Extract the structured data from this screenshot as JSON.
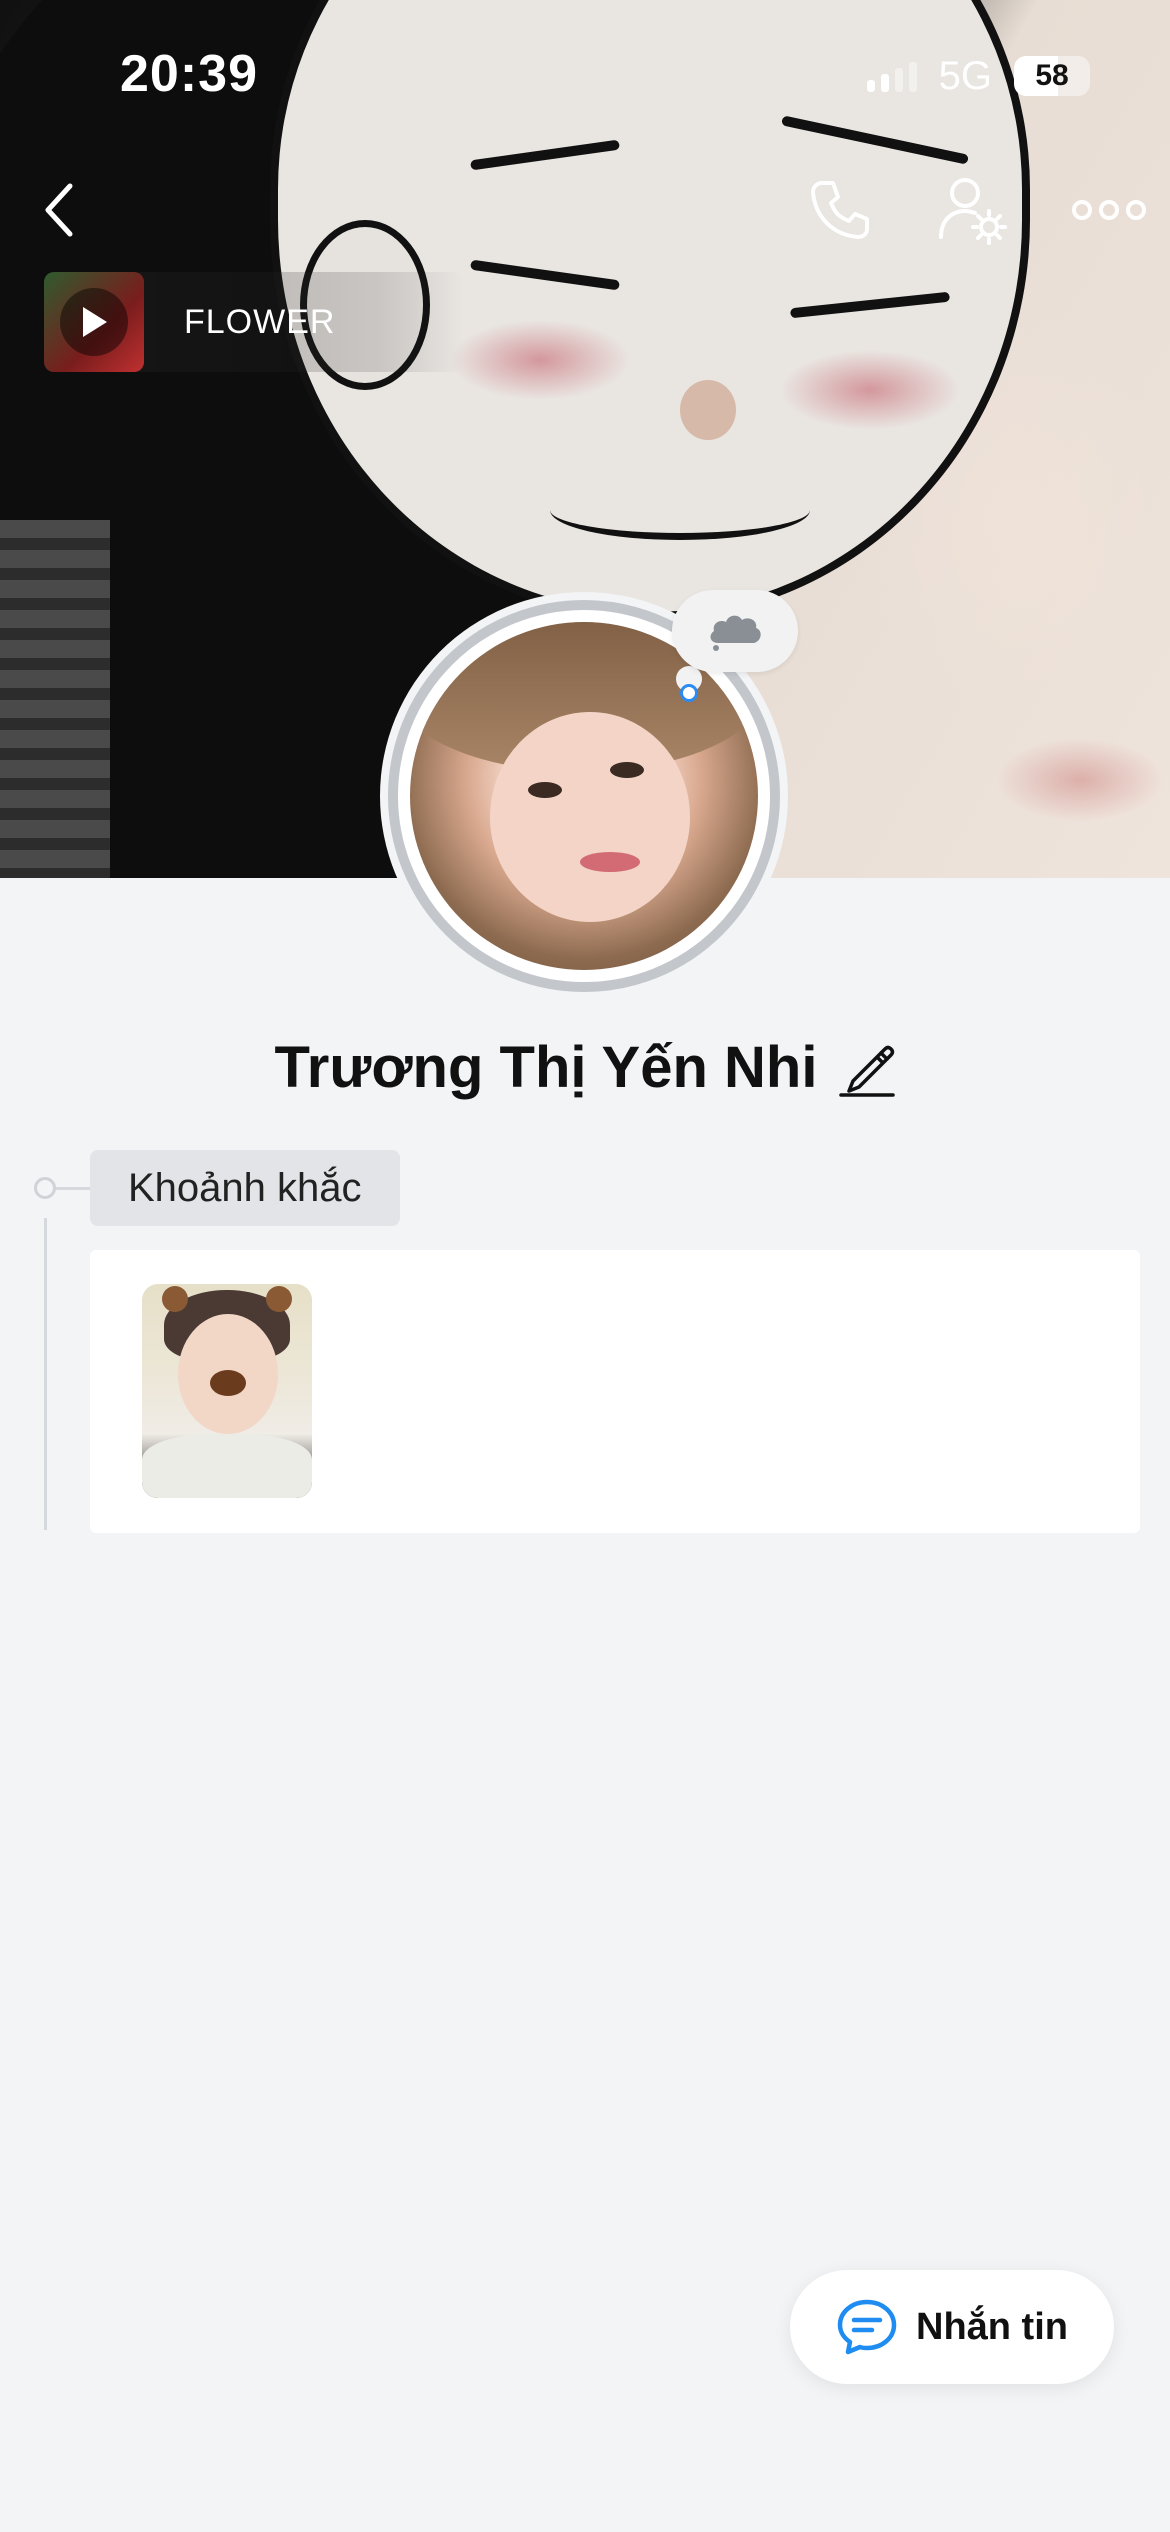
{
  "status_bar": {
    "time": "20:39",
    "network": "5G",
    "battery_percent": "58",
    "signal_bars_active": 2,
    "signal_bars_total": 4
  },
  "header": {
    "back_icon": "chevron-left-icon",
    "call_icon": "phone-icon",
    "settings_icon": "user-settings-icon",
    "more_icon": "more-horizontal-icon"
  },
  "music": {
    "title": "FLOWER",
    "play_icon": "play-icon"
  },
  "profile": {
    "name": "Trương Thị Yến Nhi",
    "edit_icon": "pencil-icon",
    "status_icon": "thought-cloud-icon"
  },
  "moments": {
    "label": "Khoảnh khắc"
  },
  "actions": {
    "message_label": "Nhắn tin",
    "message_icon": "chat-bubble-icon"
  },
  "colors": {
    "accent": "#1e8cf0",
    "background": "#f3f4f6",
    "card": "#ffffff",
    "tag_background": "#e2e4e7"
  }
}
